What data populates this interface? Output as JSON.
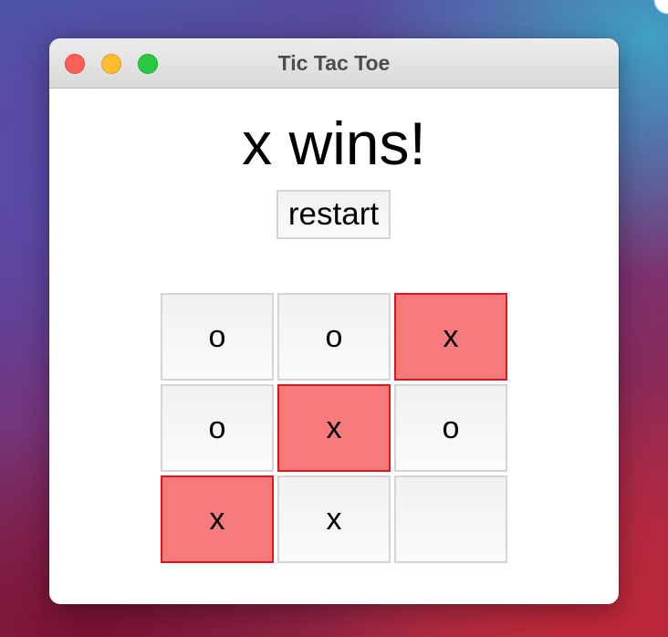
{
  "window": {
    "title": "Tic Tac Toe"
  },
  "game": {
    "status": "x wins!",
    "restart_label": "restart",
    "board": [
      [
        {
          "mark": "o",
          "win": false
        },
        {
          "mark": "o",
          "win": false
        },
        {
          "mark": "x",
          "win": true
        }
      ],
      [
        {
          "mark": "o",
          "win": false
        },
        {
          "mark": "x",
          "win": true
        },
        {
          "mark": "o",
          "win": false
        }
      ],
      [
        {
          "mark": "x",
          "win": true
        },
        {
          "mark": "x",
          "win": false
        },
        {
          "mark": "",
          "win": false
        }
      ]
    ]
  },
  "colors": {
    "win_fill": "#f77a7c",
    "win_border": "#e0161e",
    "cell_border": "#d4d4d4"
  }
}
